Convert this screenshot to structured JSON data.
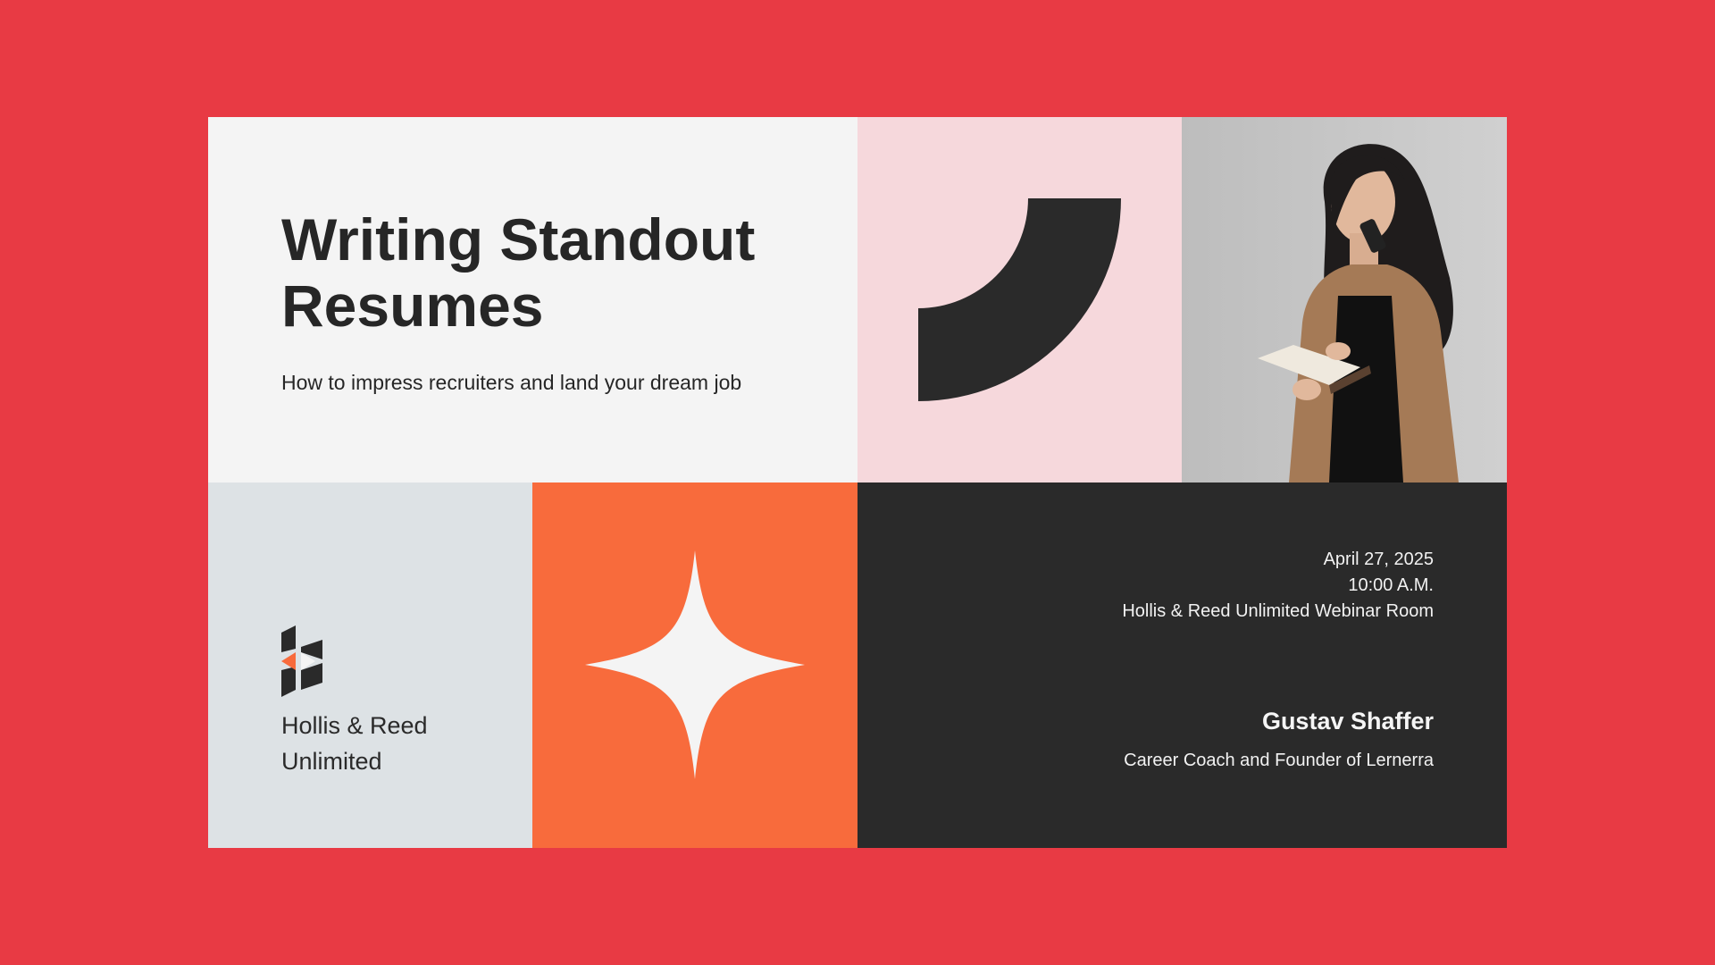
{
  "slide": {
    "title_line1": "Writing Standout",
    "title_line2": "Resumes",
    "subtitle": "How to impress recruiters and land your dream job",
    "company_line1": "Hollis & Reed",
    "company_line2": "Unlimited",
    "date": "April 27, 2025",
    "time": "10:00 A.M.",
    "location": "Hollis & Reed Unlimited Webinar Room",
    "speaker_name": "Gustav Shaffer",
    "speaker_role": "Career Coach and Founder of Lernerra"
  },
  "colors": {
    "background": "#e83a44",
    "title_panel": "#f4f4f4",
    "pink_panel": "#f6d8dc",
    "logo_panel": "#dde2e5",
    "orange_panel": "#f86b3c",
    "dark_panel": "#2a2a2a",
    "text_dark": "#262626",
    "text_light": "#f2f2f2"
  },
  "icons": {
    "arc_shape": "quarter-arc-icon",
    "star_shape": "four-point-star-icon",
    "logo": "hollis-reed-logo"
  }
}
